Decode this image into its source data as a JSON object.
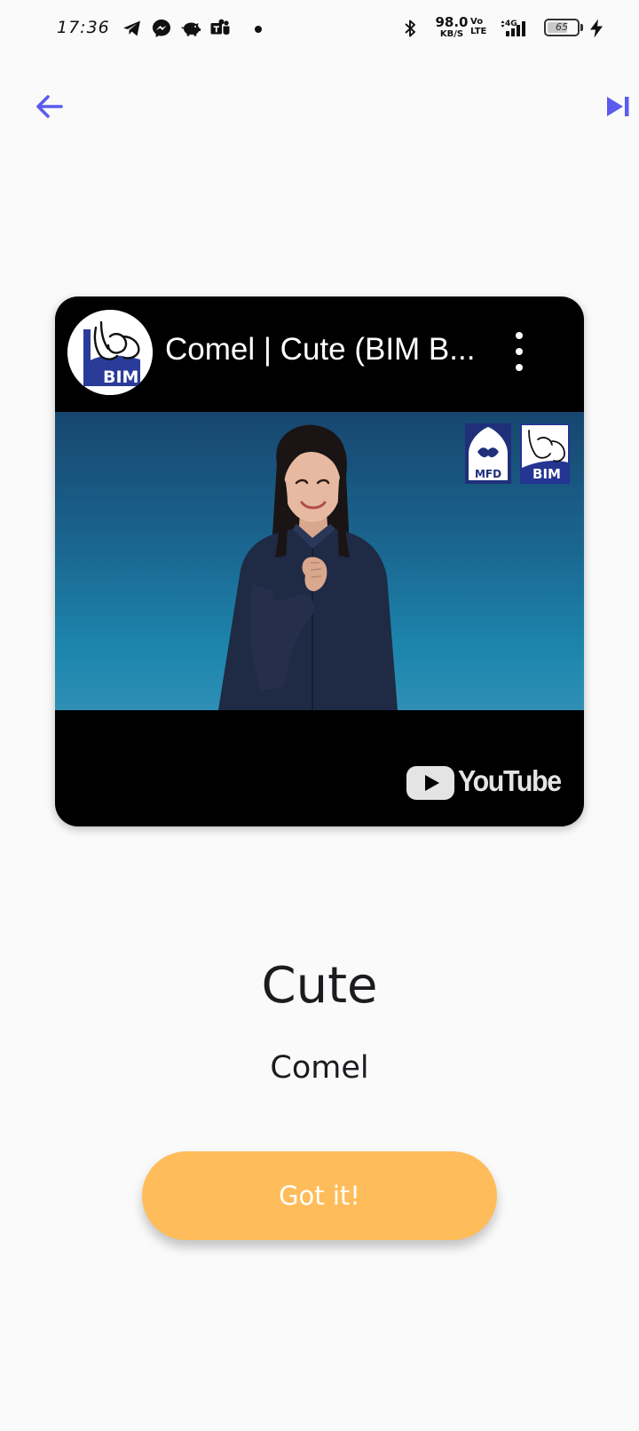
{
  "status_bar": {
    "time": "17:36",
    "network_speed_value": "98.0",
    "network_speed_unit": "KB/S",
    "volte_top": "Vo",
    "volte_bottom": "LTE",
    "network_type": "4G",
    "battery_level": "65",
    "icons": [
      "telegram-icon",
      "messenger-icon",
      "piggy-bank-icon",
      "teams-icon",
      "notification-dot",
      "bluetooth-icon",
      "signal-icon",
      "battery-icon",
      "charging-icon"
    ]
  },
  "nav": {
    "back_icon": "arrow-left-icon",
    "skip_icon": "skip-next-icon",
    "accent_color": "#5b5bf0"
  },
  "video": {
    "title": "Comel | Cute (BIM B...",
    "channel_avatar_text": "BIM",
    "overlay_logo_1": "MFD",
    "overlay_logo_2": "BIM",
    "platform_label": "YouTube",
    "menu_icon": "more-vert-icon"
  },
  "word": {
    "english": "Cute",
    "malay": "Comel"
  },
  "button": {
    "label": "Got it!",
    "color": "#ffbc5a"
  }
}
